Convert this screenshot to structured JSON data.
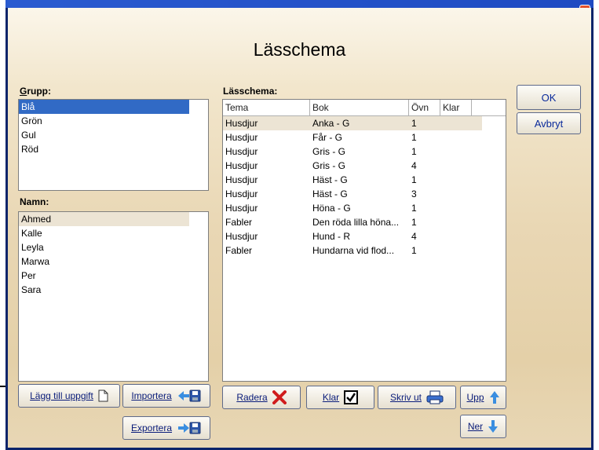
{
  "window": {
    "title": "Lässchema",
    "close_glyph": "✕"
  },
  "grupp": {
    "label": "Grupp:",
    "items": [
      "Blå",
      "Grön",
      "Gul",
      "Röd"
    ],
    "selected_index": 0
  },
  "namn": {
    "label": "Namn:",
    "items": [
      "Ahmed",
      "Kalle",
      "Leyla",
      "Marwa",
      "Per",
      "Sara"
    ],
    "highlight_index": 0
  },
  "schema": {
    "label": "Lässchema:",
    "columns": [
      "Tema",
      "Bok",
      "Övn",
      "Klar"
    ],
    "rows": [
      [
        "Husdjur",
        "Anka - G",
        "1",
        ""
      ],
      [
        "Husdjur",
        "Får - G",
        "1",
        ""
      ],
      [
        "Husdjur",
        "Gris - G",
        "1",
        ""
      ],
      [
        "Husdjur",
        "Gris - G",
        "4",
        ""
      ],
      [
        "Husdjur",
        "Häst - G",
        "1",
        ""
      ],
      [
        "Husdjur",
        "Häst - G",
        "3",
        ""
      ],
      [
        "Husdjur",
        "Höna - G",
        "1",
        ""
      ],
      [
        "Fabler",
        "Den röda lilla höna...",
        "1",
        ""
      ],
      [
        "Husdjur",
        "Hund - R",
        "4",
        ""
      ],
      [
        "Fabler",
        "Hundarna vid flod...",
        "1",
        ""
      ]
    ]
  },
  "buttons": {
    "ok": "OK",
    "cancel": "Avbryt",
    "add_task": "Lägg till uppgift",
    "import": "Importera",
    "export": "Exportera",
    "delete": "Radera",
    "done": "Klar",
    "print": "Skriv ut",
    "up": "Upp",
    "down": "Ner"
  },
  "colors": {
    "selection": "#316ac5",
    "delete_icon": "#d01c1c",
    "arrow_icon": "#3a8ee0",
    "link_text": "#0a1c7a"
  }
}
